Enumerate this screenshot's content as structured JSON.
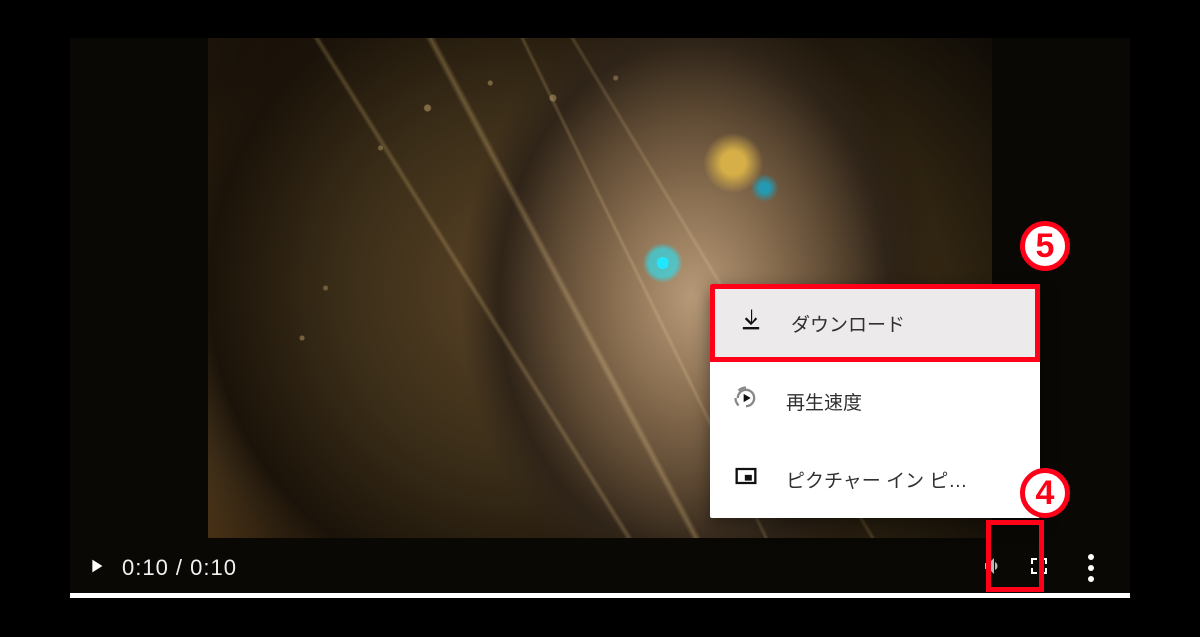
{
  "player": {
    "current_time": "0:10",
    "duration": "0:10",
    "time_display": "0:10 / 0:10"
  },
  "menu": {
    "items": [
      {
        "id": "download",
        "label": "ダウンロード",
        "highlight": true
      },
      {
        "id": "speed",
        "label": "再生速度"
      },
      {
        "id": "pip",
        "label": "ピクチャー イン ピ…"
      }
    ]
  },
  "annotations": {
    "more_button": "4",
    "download_item": "5"
  },
  "colors": {
    "annotation": "#ff0019"
  }
}
